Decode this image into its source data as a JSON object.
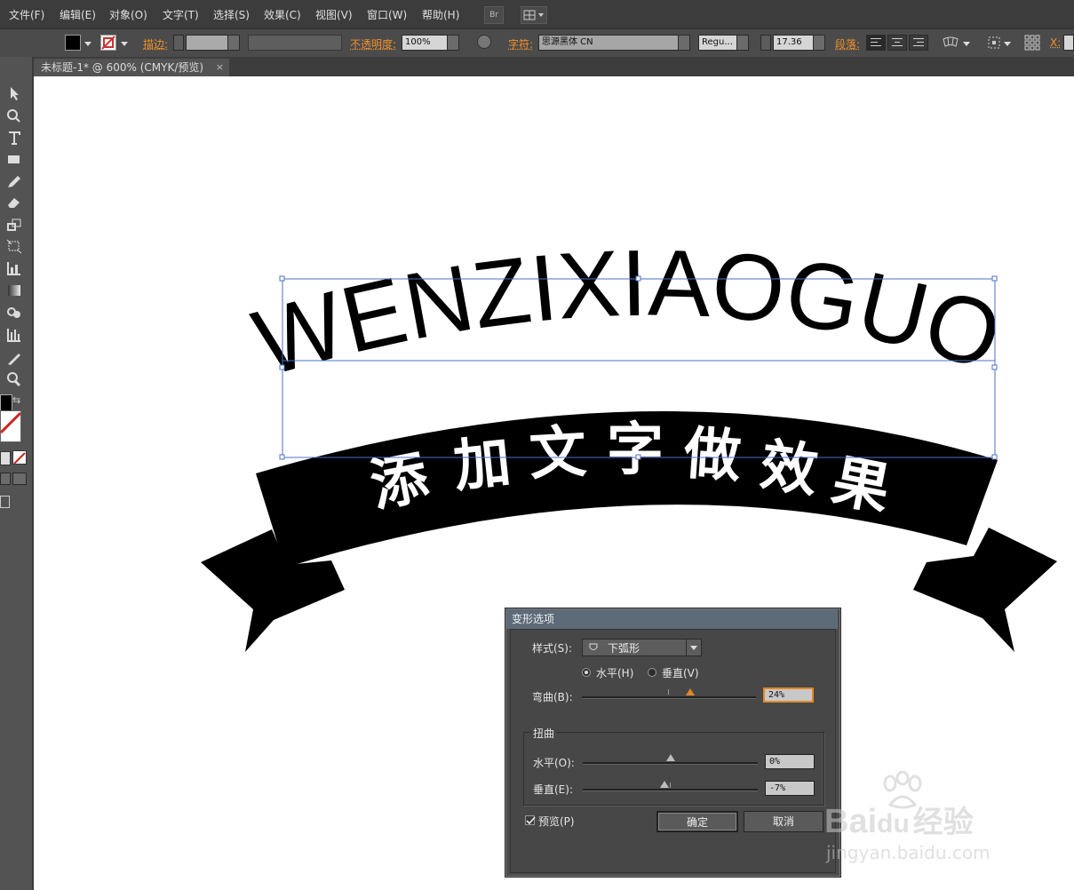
{
  "menubar": {
    "items": [
      "文件(F)",
      "编辑(E)",
      "对象(O)",
      "文字(T)",
      "选择(S)",
      "效果(C)",
      "视图(V)",
      "窗口(W)",
      "帮助(H)"
    ],
    "bridge_label": "Br"
  },
  "controlbar": {
    "stroke_label": "描边:",
    "opacity_label": "不透明度:",
    "opacity_value": "100%",
    "char_label": "字符:",
    "font_family": "思源黑体 CN",
    "font_style": "Regu...",
    "font_size": "17.36",
    "paragraph_label": "段落:",
    "x_label": "X:"
  },
  "document_tab": {
    "title": "未标题-1* @ 600% (CMYK/预览)",
    "close": "×"
  },
  "artwork": {
    "arc_text": "WENZIXIAOGUO",
    "banner_text": [
      "添",
      "加",
      "文",
      "字",
      "做",
      "效",
      "果"
    ],
    "fill_color": "#000000",
    "selection_color": "#4a72c8"
  },
  "dialog": {
    "title": "变形选项",
    "style_label": "样式(S):",
    "style_value": "下弧形",
    "horizontal_label": "水平(H)",
    "vertical_label": "垂直(V)",
    "orientation_selected": "horizontal",
    "bend_label": "弯曲(B):",
    "bend_value": "24%",
    "bend_fraction": 0.62,
    "distortion_label": "扭曲",
    "dist_h_label": "水平(O):",
    "dist_h_value": "0%",
    "dist_h_fraction": 0.5,
    "dist_v_label": "垂直(E):",
    "dist_v_value": "-7%",
    "dist_v_fraction": 0.465,
    "preview_label": "预览(P)",
    "preview_checked": true,
    "ok_label": "确定",
    "cancel_label": "取消"
  },
  "watermark": {
    "brand_text": "Bai",
    "brand_suffix": "du",
    "cn_text": "经验",
    "url": "jingyan.baidu.com"
  }
}
